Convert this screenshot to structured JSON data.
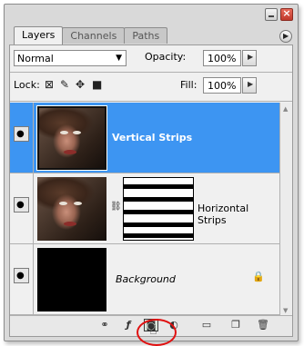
{
  "tabs": [
    {
      "label": "Layers"
    },
    {
      "label": "Channels"
    },
    {
      "label": "Paths"
    }
  ],
  "controls": {
    "blend_mode": "Normal",
    "opacity_label": "Opacity:",
    "opacity_value": "100%",
    "lock_label": "Lock:",
    "fill_label": "Fill:",
    "fill_value": "100%"
  },
  "layers": [
    {
      "name": "Vertical Strips",
      "selected": true
    },
    {
      "name": "Horizontal Strips",
      "selected": false
    },
    {
      "name": "Background",
      "selected": false
    }
  ],
  "icons": {
    "lock_options": [
      "lock-transparent-icon",
      "lock-image-icon",
      "lock-position-icon",
      "lock-all-icon"
    ],
    "bottom_bar": [
      "link-layers-icon",
      "layer-style-icon",
      "add-mask-icon",
      "adjustment-layer-icon",
      "new-group-icon",
      "new-layer-icon",
      "delete-layer-icon"
    ]
  },
  "colors": {
    "selection": "#3d95f2",
    "callout": "#e01010"
  }
}
